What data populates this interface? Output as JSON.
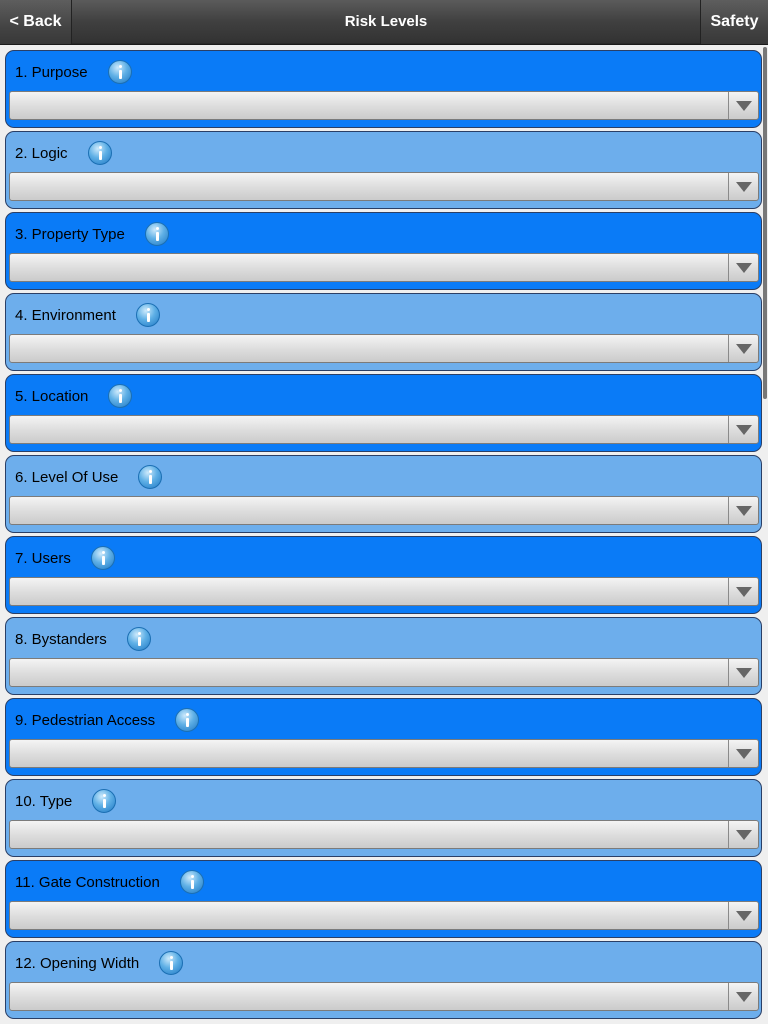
{
  "header": {
    "back_label": "< Back",
    "title": "Risk Levels",
    "safety_label": "Safety"
  },
  "items": [
    {
      "label": "1. Purpose",
      "value": ""
    },
    {
      "label": "2. Logic",
      "value": ""
    },
    {
      "label": "3. Property Type",
      "value": ""
    },
    {
      "label": "4. Environment",
      "value": ""
    },
    {
      "label": "5. Location",
      "value": ""
    },
    {
      "label": "6. Level Of Use",
      "value": ""
    },
    {
      "label": "7. Users",
      "value": ""
    },
    {
      "label": "8. Bystanders",
      "value": ""
    },
    {
      "label": "9. Pedestrian Access",
      "value": ""
    },
    {
      "label": "10. Type",
      "value": ""
    },
    {
      "label": "11. Gate Construction",
      "value": ""
    },
    {
      "label": "12. Opening Width",
      "value": ""
    }
  ],
  "colors": {
    "card_dark": "#0a7bf7",
    "card_light": "#6daeec",
    "header": "#404040"
  }
}
